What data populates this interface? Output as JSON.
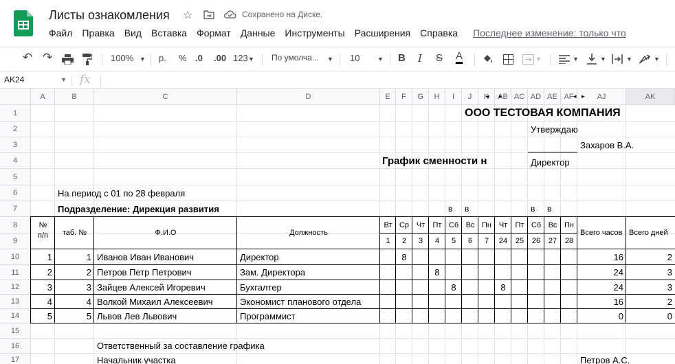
{
  "app": {
    "title": "Листы ознакомления",
    "saved_status": "Сохранено на Диске.",
    "menu": [
      "Файл",
      "Правка",
      "Вид",
      "Вставка",
      "Формат",
      "Данные",
      "Инструменты",
      "Расширения",
      "Справка"
    ],
    "last_edit": "Последнее изменение: только что"
  },
  "toolbar": {
    "zoom": "100%",
    "currency": "р.",
    "percent": "%",
    "dec_less": ".0",
    "dec_more": ".00",
    "format_more": "123",
    "font": "По умолча...",
    "font_size": "10",
    "bold": "B",
    "italic": "I",
    "strike": "S",
    "text_color": "A"
  },
  "formula_bar": {
    "cell_ref": "AK24",
    "fx": "fx",
    "value": ""
  },
  "columns": [
    "A",
    "B",
    "C",
    "D",
    "E",
    "F",
    "G",
    "H",
    "I",
    "J",
    "K",
    "AB",
    "AC",
    "AD",
    "AE",
    "AF",
    "AJ",
    "AK"
  ],
  "rows": [
    "1",
    "2",
    "3",
    "4",
    "5",
    "6",
    "7",
    "8",
    "9",
    "10",
    "11",
    "12",
    "13",
    "14",
    "15",
    "16",
    "17"
  ],
  "sheet": {
    "company": "ООО ТЕСТОВАЯ КОМПАНИЯ",
    "approve": "Утверждаю",
    "approver": "Захаров В.А.",
    "doc_title": "График сменности н",
    "position": "Директор",
    "period": "На период с 01 по 28 февраля",
    "department": "Подразделение: Дирекция развития",
    "weekend_mark": "в",
    "h_num": "№\nп/п",
    "h_tab": "таб. №",
    "h_fio": "Ф.И.О",
    "h_pos": "Должность",
    "days": [
      "Вт",
      "Ср",
      "Чт",
      "Пт",
      "Сб",
      "Вс",
      "Пн",
      "Чт",
      "Пт",
      "Сб",
      "Вс",
      "Пн"
    ],
    "dates": [
      "1",
      "2",
      "3",
      "4",
      "5",
      "6",
      "7",
      "24",
      "25",
      "26",
      "27",
      "28"
    ],
    "h_hours": "Всего часов",
    "h_days": "Всего дней",
    "employees": [
      {
        "num": "1",
        "tab": "1",
        "fio": "Иванов Иван Иванович",
        "pos": "Директор",
        "hours": "16",
        "days": "2"
      },
      {
        "num": "2",
        "tab": "2",
        "fio": "Петров Петр Петрович",
        "pos": "Зам. Директора",
        "hours": "24",
        "days": "3"
      },
      {
        "num": "3",
        "tab": "3",
        "fio": "Зайцев Алексей Игоревич",
        "pos": "Бухгалтер",
        "hours": "24",
        "days": "3"
      },
      {
        "num": "4",
        "tab": "4",
        "fio": "Волкой Михаил Алексеевич",
        "pos": "Экономист планового отдела",
        "hours": "16",
        "days": "2"
      },
      {
        "num": "5",
        "tab": "5",
        "fio": "Львов Лев Львович",
        "pos": "Программист",
        "hours": "0",
        "days": "0"
      }
    ],
    "shift_value": "8",
    "responsible": "Ответственный за составление графика",
    "site_head": "Начальник участка",
    "signer": "Петров А.С."
  }
}
